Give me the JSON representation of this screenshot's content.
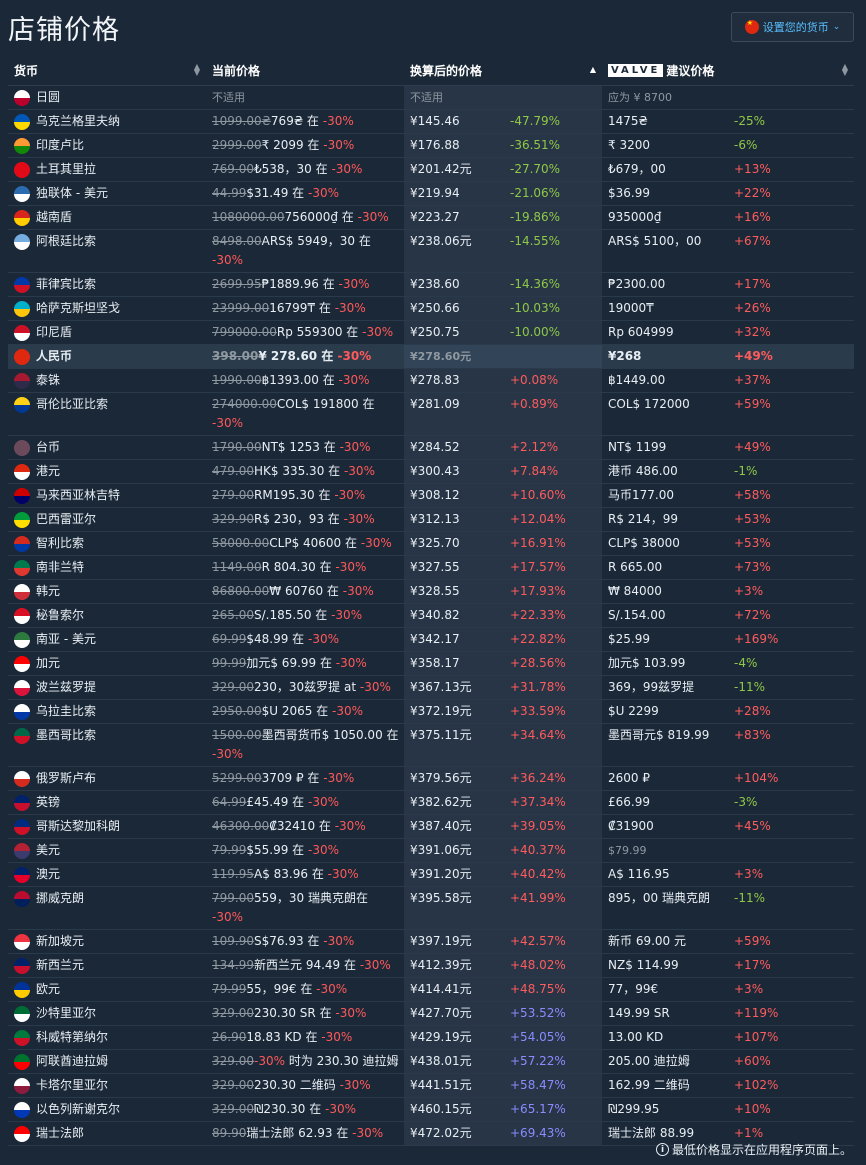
{
  "page": {
    "title": "店铺价格"
  },
  "currency_button": {
    "label": "设置您的货币"
  },
  "headers": {
    "currency": "货币",
    "current": "当前价格",
    "converted": "换算后的价格",
    "valve_logo": "VALVE",
    "recommended": "建议价格"
  },
  "footer": {
    "note": "最低价格显示在应用程序页面上。"
  },
  "colors": {
    "background": "#1b2838",
    "discount": "#ff5959",
    "lower": "#8fc846",
    "higher": "#ff5c5c",
    "much_higher": "#8b8bff"
  },
  "rows": [
    {
      "currency": "日圆",
      "flag": [
        "#ffffff",
        "#bc002d"
      ],
      "orig": "",
      "price": "不适用",
      "disc": "",
      "conv": "不适用",
      "pct": "",
      "pct_class": "",
      "rec": "应为 ¥ 8700",
      "rec_pct": "",
      "rec_class": "",
      "na": true
    },
    {
      "currency": "乌克兰格里夫纳",
      "flag": [
        "#0057b7",
        "#ffd700"
      ],
      "orig": "1099.00₴",
      "price": "769₴ 在 ",
      "disc": "-30%",
      "conv": "¥145.46",
      "pct": "-47.79%",
      "pct_class": "green",
      "rec": "1475₴",
      "rec_pct": "-25%",
      "rec_class": "green"
    },
    {
      "currency": "印度卢比",
      "flag": [
        "#ff9933",
        "#138808"
      ],
      "orig": "2999.00",
      "price": "₹ 2099 在 ",
      "disc": "-30%",
      "conv": "¥176.88",
      "pct": "-36.51%",
      "pct_class": "green",
      "rec": "₹ 3200",
      "rec_pct": "-6%",
      "rec_class": "green"
    },
    {
      "currency": "土耳其里拉",
      "flag": [
        "#e30a17",
        "#e30a17"
      ],
      "orig": "769.00",
      "price": "₺538，30 在 ",
      "disc": "-30%",
      "conv": "¥201.42元",
      "pct": "-27.70%",
      "pct_class": "green",
      "rec": "₺679，00",
      "rec_pct": "+13%",
      "rec_class": "red"
    },
    {
      "currency": "独联体 - 美元",
      "flag": [
        "#2b6cb0",
        "#ffffff"
      ],
      "orig": "44.99",
      "price": "$31.49 在 ",
      "disc": "-30%",
      "conv": "¥219.94",
      "pct": "-21.06%",
      "pct_class": "green",
      "rec": "$36.99",
      "rec_pct": "+22%",
      "rec_class": "red"
    },
    {
      "currency": "越南盾",
      "flag": [
        "#da251d",
        "#ffcd00"
      ],
      "orig": "1080000.00",
      "price": "756000₫ 在 ",
      "disc": "-30%",
      "conv": "¥223.27",
      "pct": "-19.86%",
      "pct_class": "green",
      "rec": "935000₫",
      "rec_pct": "+16%",
      "rec_class": "red"
    },
    {
      "currency": "阿根廷比索",
      "flag": [
        "#74acdf",
        "#ffffff"
      ],
      "orig": "8498.00",
      "price": "ARS$ 5949，30 在 ",
      "disc": "-30%",
      "conv": "¥238.06元",
      "pct": "-14.55%",
      "pct_class": "green",
      "rec": "ARS$ 5100，00",
      "rec_pct": "+67%",
      "rec_class": "red",
      "tall": true
    },
    {
      "currency": "菲律宾比索",
      "flag": [
        "#0038a8",
        "#ce1126"
      ],
      "orig": "2699.95",
      "price": "₱1889.96 在 ",
      "disc": "-30%",
      "conv": "¥238.60",
      "pct": "-14.36%",
      "pct_class": "green",
      "rec": "₱2300.00",
      "rec_pct": "+17%",
      "rec_class": "red"
    },
    {
      "currency": "哈萨克斯坦坚戈",
      "flag": [
        "#00afca",
        "#fec50c"
      ],
      "orig": "23999.00",
      "price": "16799₸ 在 ",
      "disc": "-30%",
      "conv": "¥250.66",
      "pct": "-10.03%",
      "pct_class": "green",
      "rec": "19000₸",
      "rec_pct": "+26%",
      "rec_class": "red"
    },
    {
      "currency": "印尼盾",
      "flag": [
        "#ce1126",
        "#ffffff"
      ],
      "orig": "799000.00",
      "price": "Rp 559300 在 ",
      "disc": "-30%",
      "conv": "¥250.75",
      "pct": "-10.00%",
      "pct_class": "green",
      "rec": "Rp 604999",
      "rec_pct": "+32%",
      "rec_class": "red"
    },
    {
      "currency": "人民币",
      "flag": [
        "#de2910",
        "#de2910"
      ],
      "orig": "398.00",
      "price": "¥ 278.60 在 ",
      "disc": "-30%",
      "conv": "¥278.60元",
      "pct": "",
      "pct_class": "",
      "rec": "¥268",
      "rec_pct": "+49%",
      "rec_class": "red",
      "hl": true
    },
    {
      "currency": "泰铢",
      "flag": [
        "#a51931",
        "#2d2a4a"
      ],
      "orig": "1990.00",
      "price": "฿1393.00 在 ",
      "disc": "-30%",
      "conv": "¥278.83",
      "pct": "+0.08%",
      "pct_class": "red",
      "rec": "฿1449.00",
      "rec_pct": "+37%",
      "rec_class": "red"
    },
    {
      "currency": "哥伦比亚比索",
      "flag": [
        "#fcd116",
        "#003893"
      ],
      "orig": "274000.00",
      "price": "COL$ 191800 在 ",
      "disc": "-30%",
      "conv": "¥281.09",
      "pct": "+0.89%",
      "pct_class": "red",
      "rec": "COL$ 172000",
      "rec_pct": "+59%",
      "rec_class": "red",
      "tall": true
    },
    {
      "currency": "台币",
      "flag": [
        "#6b4a5c",
        "#6b4a5c"
      ],
      "orig": "1790.00",
      "price": "NT$ 1253 在 ",
      "disc": "-30%",
      "conv": "¥284.52",
      "pct": "+2.12%",
      "pct_class": "red",
      "rec": "NT$ 1199",
      "rec_pct": "+49%",
      "rec_class": "red"
    },
    {
      "currency": "港元",
      "flag": [
        "#de2910",
        "#ffffff"
      ],
      "orig": "479.00",
      "price": "HK$ 335.30 在 ",
      "disc": "-30%",
      "conv": "¥300.43",
      "pct": "+7.84%",
      "pct_class": "red",
      "rec": "港币 486.00",
      "rec_pct": "-1%",
      "rec_class": "green"
    },
    {
      "currency": "马来西亚林吉特",
      "flag": [
        "#cc0001",
        "#010066"
      ],
      "orig": "279.00",
      "price": "RM195.30 在 ",
      "disc": "-30%",
      "conv": "¥308.12",
      "pct": "+10.60%",
      "pct_class": "red",
      "rec": "马币177.00",
      "rec_pct": "+58%",
      "rec_class": "red"
    },
    {
      "currency": "巴西雷亚尔",
      "flag": [
        "#009c3b",
        "#ffdf00"
      ],
      "orig": "329.90",
      "price": "R$ 230，93 在 ",
      "disc": "-30%",
      "conv": "¥312.13",
      "pct": "+12.04%",
      "pct_class": "red",
      "rec": "R$ 214，99",
      "rec_pct": "+53%",
      "rec_class": "red"
    },
    {
      "currency": "智利比索",
      "flag": [
        "#d52b1e",
        "#0039a6"
      ],
      "orig": "58000.00",
      "price": "CLP$ 40600 在 ",
      "disc": "-30%",
      "conv": "¥325.70",
      "pct": "+16.91%",
      "pct_class": "red",
      "rec": "CLP$ 38000",
      "rec_pct": "+53%",
      "rec_class": "red"
    },
    {
      "currency": "南非兰特",
      "flag": [
        "#007a4d",
        "#de3831"
      ],
      "orig": "1149.00",
      "price": "R 804.30 在 ",
      "disc": "-30%",
      "conv": "¥327.55",
      "pct": "+17.57%",
      "pct_class": "red",
      "rec": "R 665.00",
      "rec_pct": "+73%",
      "rec_class": "red"
    },
    {
      "currency": "韩元",
      "flag": [
        "#ffffff",
        "#cd2e3a"
      ],
      "orig": "86800.00",
      "price": "₩ 60760 在 ",
      "disc": "-30%",
      "conv": "¥328.55",
      "pct": "+17.93%",
      "pct_class": "red",
      "rec": "₩ 84000",
      "rec_pct": "+3%",
      "rec_class": "red"
    },
    {
      "currency": "秘鲁索尔",
      "flag": [
        "#d91023",
        "#ffffff"
      ],
      "orig": "265.00",
      "price": "S/.185.50 在 ",
      "disc": "-30%",
      "conv": "¥340.82",
      "pct": "+22.33%",
      "pct_class": "red",
      "rec": "S/.154.00",
      "rec_pct": "+72%",
      "rec_class": "red"
    },
    {
      "currency": "南亚 - 美元",
      "flag": [
        "#2d7a3e",
        "#ffffff"
      ],
      "orig": "69.99",
      "price": "$48.99 在 ",
      "disc": "-30%",
      "conv": "¥342.17",
      "pct": "+22.82%",
      "pct_class": "red",
      "rec": "$25.99",
      "rec_pct": "+169%",
      "rec_class": "red"
    },
    {
      "currency": "加元",
      "flag": [
        "#ff0000",
        "#ffffff"
      ],
      "orig": "99.99",
      "price": "加元$ 69.99 在 ",
      "disc": "-30%",
      "conv": "¥358.17",
      "pct": "+28.56%",
      "pct_class": "red",
      "rec": "加元$ 103.99",
      "rec_pct": "-4%",
      "rec_class": "green"
    },
    {
      "currency": "波兰兹罗提",
      "flag": [
        "#ffffff",
        "#dc143c"
      ],
      "orig": "329.00",
      "price": "230，30兹罗提 at ",
      "disc": "-30%",
      "conv": "¥367.13元",
      "pct": "+31.78%",
      "pct_class": "red",
      "rec": "369，99兹罗提",
      "rec_pct": "-11%",
      "rec_class": "green"
    },
    {
      "currency": "乌拉圭比索",
      "flag": [
        "#ffffff",
        "#0038a8"
      ],
      "orig": "2950.00",
      "price": "$U 2065 在 ",
      "disc": "-30%",
      "conv": "¥372.19元",
      "pct": "+33.59%",
      "pct_class": "red",
      "rec": "$U 2299",
      "rec_pct": "+28%",
      "rec_class": "red"
    },
    {
      "currency": "墨西哥比索",
      "flag": [
        "#006847",
        "#ce1126"
      ],
      "orig": "1500.00",
      "price": "墨西哥货币$ 1050.00 在 ",
      "disc": "-30%",
      "conv": "¥375.11元",
      "pct": "+34.64%",
      "pct_class": "red",
      "rec": "墨西哥元$ 819.99",
      "rec_pct": "+83%",
      "rec_class": "red",
      "tall": true
    },
    {
      "currency": "俄罗斯卢布",
      "flag": [
        "#ffffff",
        "#d52b1e"
      ],
      "orig": "5299.00",
      "price": "3709 ₽ 在 ",
      "disc": "-30%",
      "conv": "¥379.56元",
      "pct": "+36.24%",
      "pct_class": "red",
      "rec": "2600 ₽",
      "rec_pct": "+104%",
      "rec_class": "red"
    },
    {
      "currency": "英镑",
      "flag": [
        "#012169",
        "#c8102e"
      ],
      "orig": "64.99",
      "price": "£45.49 在 ",
      "disc": "-30%",
      "conv": "¥382.62元",
      "pct": "+37.34%",
      "pct_class": "red",
      "rec": "£66.99",
      "rec_pct": "-3%",
      "rec_class": "green"
    },
    {
      "currency": "哥斯达黎加科朗",
      "flag": [
        "#002b7f",
        "#ce1126"
      ],
      "orig": "46300.00",
      "price": "₡32410 在 ",
      "disc": "-30%",
      "conv": "¥387.40元",
      "pct": "+39.05%",
      "pct_class": "red",
      "rec": "₡31900",
      "rec_pct": "+45%",
      "rec_class": "red"
    },
    {
      "currency": "美元",
      "flag": [
        "#b22234",
        "#3c3b6e"
      ],
      "orig": "79.99",
      "price": "$55.99 在 ",
      "disc": "-30%",
      "conv": "¥391.06元",
      "pct": "+40.37%",
      "pct_class": "red",
      "rec": "$79.99",
      "rec_pct": "",
      "rec_class": "",
      "rec_gray": true
    },
    {
      "currency": "澳元",
      "flag": [
        "#012169",
        "#e4002b"
      ],
      "orig": "119.95",
      "price": "A$ 83.96 在 ",
      "disc": "-30%",
      "conv": "¥391.20元",
      "pct": "+40.42%",
      "pct_class": "red",
      "rec": "A$ 116.95",
      "rec_pct": "+3%",
      "rec_class": "red"
    },
    {
      "currency": "挪威克朗",
      "flag": [
        "#ba0c2f",
        "#00205b"
      ],
      "orig": "799.00",
      "price": "559，30 瑞典克朗在 ",
      "disc": "-30%",
      "conv": "¥395.58元",
      "pct": "+41.99%",
      "pct_class": "red",
      "rec": "895，00 瑞典克朗",
      "rec_pct": "-11%",
      "rec_class": "green",
      "tall": true
    },
    {
      "currency": "新加坡元",
      "flag": [
        "#ef3340",
        "#ffffff"
      ],
      "orig": "109.90",
      "price": "S$76.93 在 ",
      "disc": "-30%",
      "conv": "¥397.19元",
      "pct": "+42.57%",
      "pct_class": "red",
      "rec": "新币 69.00 元",
      "rec_pct": "+59%",
      "rec_class": "red"
    },
    {
      "currency": "新西兰元",
      "flag": [
        "#012169",
        "#c8102e"
      ],
      "orig": "134.99",
      "price": "新西兰元 94.49 在 ",
      "disc": "-30%",
      "conv": "¥412.39元",
      "pct": "+48.02%",
      "pct_class": "red",
      "rec": "NZ$ 114.99",
      "rec_pct": "+17%",
      "rec_class": "red"
    },
    {
      "currency": "欧元",
      "flag": [
        "#003399",
        "#ffcc00"
      ],
      "orig": "79.99",
      "price": "55，99€ 在 ",
      "disc": "-30%",
      "conv": "¥414.41元",
      "pct": "+48.75%",
      "pct_class": "red",
      "rec": "77，99€",
      "rec_pct": "+3%",
      "rec_class": "red"
    },
    {
      "currency": "沙特里亚尔",
      "flag": [
        "#006c35",
        "#ffffff"
      ],
      "orig": "329.00",
      "price": "230.30 SR 在 ",
      "disc": "-30%",
      "conv": "¥427.70元",
      "pct": "+53.52%",
      "pct_class": "blue",
      "rec": "149.99 SR",
      "rec_pct": "+119%",
      "rec_class": "red"
    },
    {
      "currency": "科威特第纳尔",
      "flag": [
        "#007a3d",
        "#ce1126"
      ],
      "orig": "26.90",
      "price": "18.83 KD 在 ",
      "disc": "-30%",
      "conv": "¥429.19元",
      "pct": "+54.05%",
      "pct_class": "blue",
      "rec": "13.00 KD",
      "rec_pct": "+107%",
      "rec_class": "red"
    },
    {
      "currency": "阿联酋迪拉姆",
      "flag": [
        "#00732f",
        "#ff0000"
      ],
      "orig": "329.00",
      "price": "",
      "disc": "-30%",
      "disc_tail": " 时为 230.30 迪拉姆",
      "conv": "¥438.01元",
      "pct": "+57.22%",
      "pct_class": "blue",
      "rec": "205.00 迪拉姆",
      "rec_pct": "+60%",
      "rec_class": "red",
      "tall": true,
      "disc_first": true
    },
    {
      "currency": "卡塔尔里亚尔",
      "flag": [
        "#ffffff",
        "#8d1b3d"
      ],
      "orig": "329.00",
      "price": "230.30 二维码 ",
      "disc": "-30%",
      "conv": "¥441.51元",
      "pct": "+58.47%",
      "pct_class": "blue",
      "rec": "162.99 二维码",
      "rec_pct": "+102%",
      "rec_class": "red"
    },
    {
      "currency": "以色列新谢克尔",
      "flag": [
        "#ffffff",
        "#0038b8"
      ],
      "orig": "329.00",
      "price": "₪230.30 在 ",
      "disc": "-30%",
      "conv": "¥460.15元",
      "pct": "+65.17%",
      "pct_class": "blue",
      "rec": "₪299.95",
      "rec_pct": "+10%",
      "rec_class": "red"
    },
    {
      "currency": "瑞士法郎",
      "flag": [
        "#ff0000",
        "#ffffff"
      ],
      "orig": "89.90",
      "price": "瑞士法郎 62.93 在 ",
      "disc": "-30%",
      "conv": "¥472.02元",
      "pct": "+69.43%",
      "pct_class": "blue",
      "rec": "瑞士法郎 88.99",
      "rec_pct": "+1%",
      "rec_class": "red"
    }
  ]
}
